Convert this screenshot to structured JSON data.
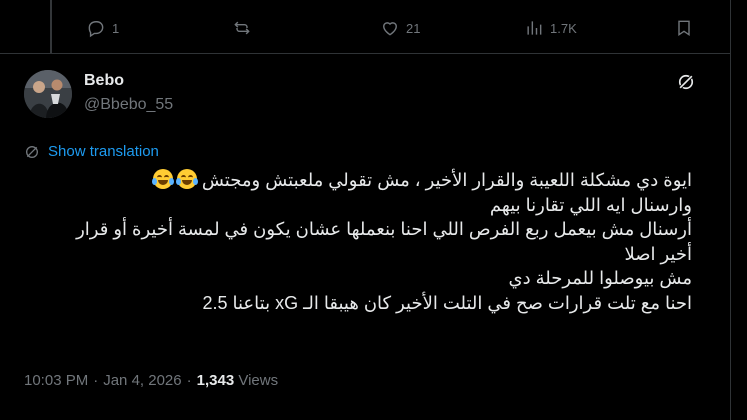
{
  "actions": {
    "replies": "1",
    "reposts": "",
    "likes": "21",
    "views": "1.7K"
  },
  "post": {
    "author_name": "Bebo",
    "author_handle": "@Bbebo_55",
    "show_translation": "Show translation",
    "text_lines": [
      "ايوة دي مشكلة اللعيبة والقرار الأخير ، مش تقولي ملعبتش ومجتش",
      "وارسنال ايه اللي تقارنا بيهم",
      "أرسنال مش بيعمل ربع الفرص اللي احنا بنعملها عشان يكون في لمسة أخيرة أو قرار",
      "أخير اصلا",
      "مش بيوصلوا للمرحلة دي",
      "احنا مع تلت قرارات صح في التلت الأخير كان هيبقا الـ xG بتاعنا 2.5"
    ],
    "emojis": [
      "face-with-tears-of-joy",
      "face-with-tears-of-joy"
    ],
    "time": "10:03 PM",
    "separator": "·",
    "date": "Jan 4, 2026",
    "views_count": "1,343",
    "views_label": "Views"
  },
  "colors": {
    "background": "#000000",
    "text": "#e7e9ea",
    "muted": "#71767b",
    "link": "#1d9bf0",
    "border": "#2f3336"
  }
}
